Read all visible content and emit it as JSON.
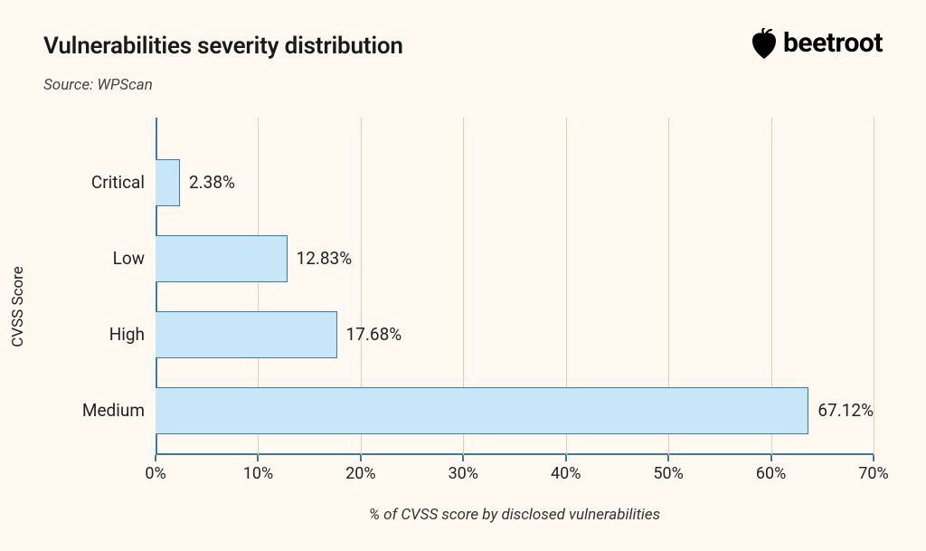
{
  "title": "Vulnerabilities severity distribution",
  "source": "Source: WPScan",
  "brand": "beetroot",
  "chart_data": {
    "type": "bar",
    "orientation": "horizontal",
    "categories": [
      "Critical",
      "Low",
      "High",
      "Medium"
    ],
    "values": [
      2.38,
      12.83,
      17.68,
      67.12
    ],
    "value_labels": [
      "2.38%",
      "12.83%",
      "17.68%",
      "67.12%"
    ],
    "xlabel": "% of CVSS score by disclosed vulnerabilities",
    "ylabel": "CVSS Score",
    "xlim": [
      0,
      70
    ],
    "xticks": [
      0,
      10,
      20,
      30,
      40,
      50,
      60,
      70
    ],
    "xtick_labels": [
      "0%",
      "10%",
      "20%",
      "30%",
      "40%",
      "50%",
      "60%",
      "70%"
    ],
    "bar_color": "#c7e6f7",
    "bar_border": "#3a7aa6",
    "grid_color": "#f3c9a3"
  }
}
